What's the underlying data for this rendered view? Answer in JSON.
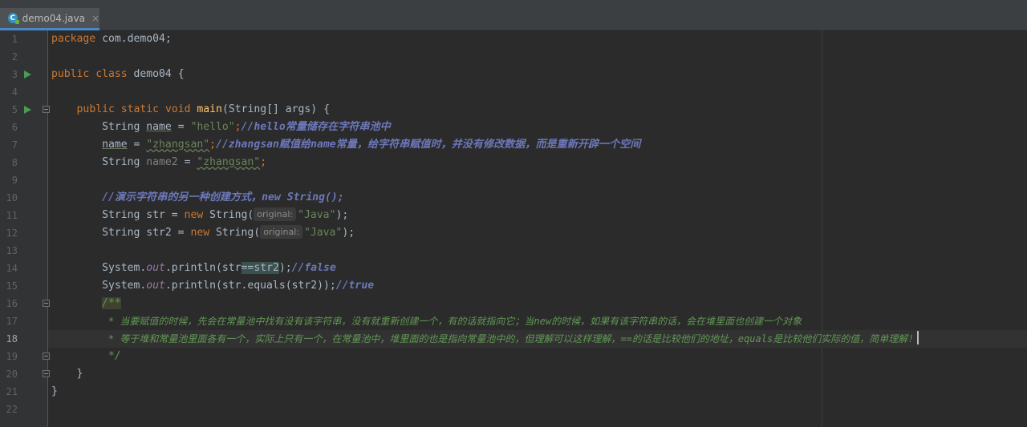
{
  "tab": {
    "title": "demo04.java",
    "close": "×",
    "icon_letter": "C"
  },
  "lines": [
    {
      "n": "1"
    },
    {
      "n": "2"
    },
    {
      "n": "3"
    },
    {
      "n": "4"
    },
    {
      "n": "5"
    },
    {
      "n": "6"
    },
    {
      "n": "7"
    },
    {
      "n": "8"
    },
    {
      "n": "9"
    },
    {
      "n": "10"
    },
    {
      "n": "11"
    },
    {
      "n": "12"
    },
    {
      "n": "13"
    },
    {
      "n": "14"
    },
    {
      "n": "15"
    },
    {
      "n": "16"
    },
    {
      "n": "17"
    },
    {
      "n": "18"
    },
    {
      "n": "19"
    },
    {
      "n": "20"
    },
    {
      "n": "21"
    },
    {
      "n": "22"
    }
  ],
  "code": {
    "l1": {
      "kw": "package",
      "rest": " com.demo04;"
    },
    "l3": {
      "kw1": "public",
      "kw2": "class",
      "name": "demo04",
      "brace": " {"
    },
    "l5": {
      "indent": "    ",
      "kw1": "public",
      "kw2": "static",
      "kw3": "void",
      "fn": "main",
      "params": "(String[] args) {"
    },
    "l6": {
      "indent": "        ",
      "type": "String ",
      "var": "name",
      "eq": " = ",
      "str": "\"hello\"",
      "semi": ";",
      "comment": "//hello常量储存在字符串池中"
    },
    "l7": {
      "indent": "        ",
      "var": "name",
      "eq": " = ",
      "str": "\"zhangsan\"",
      "semi": ";",
      "comment": "//zhangsan赋值给name常量，给字符串赋值时，并没有修改数据，而是重新开辟一个空间"
    },
    "l8": {
      "indent": "        ",
      "type": "String ",
      "var": "name2",
      "eq": " = ",
      "str": "\"zhangsan\"",
      "semi": ";"
    },
    "l10": {
      "indent": "        ",
      "comment": "//演示字符串的另一种创建方式，new String();"
    },
    "l11": {
      "indent": "        ",
      "decl": "String str = ",
      "kw": "new",
      "ctor": " String(",
      "hint": "original:",
      "str": "\"Java\"",
      "end": ");"
    },
    "l12": {
      "indent": "        ",
      "decl": "String str2 = ",
      "kw": "new",
      "ctor": " String(",
      "hint": "original:",
      "str": "\"Java\"",
      "end": ");"
    },
    "l14": {
      "indent": "        ",
      "sys": "System.",
      "out": "out",
      "call": ".println(str",
      "op": "==",
      "arg": "str2",
      "end": ");",
      "comment": "//false"
    },
    "l15": {
      "indent": "        ",
      "sys": "System.",
      "out": "out",
      "call": ".println(str.equals(str2));",
      "comment": "//true"
    },
    "l16": {
      "indent": "        ",
      "doc": "/**"
    },
    "l17": {
      "indent": "         ",
      "doc_a": "* 当要赋值的时候，先会在常量池中找有没有该字符串，没有就重新创建一个，有的话就指向它；当",
      "doc_kw": "new",
      "doc_b": "的时候，如果有该字符串的话，会在堆里面也创建一个对象"
    },
    "l18": {
      "indent": "         ",
      "doc_a": "* 等于堆和常量池里面各有一个，实际上只有一个，在常量池中，堆里面的也是指向常量池中的，但理解可以这样理解，==的话是比较他们的地址，",
      "doc_kw": "equals",
      "doc_b": "是比较他们实际的值，简单理解！"
    },
    "l19": {
      "indent": "         ",
      "doc": "*/"
    },
    "l20": {
      "indent": "    ",
      "brace": "}"
    },
    "l21": {
      "brace": "}"
    }
  },
  "colors": {
    "background": "#2b2b2b",
    "gutter": "#313335",
    "keyword": "#cc7832",
    "string": "#6a8759",
    "method": "#ffc66d",
    "comment_todo": "#6c78ba",
    "javadoc": "#629755"
  }
}
